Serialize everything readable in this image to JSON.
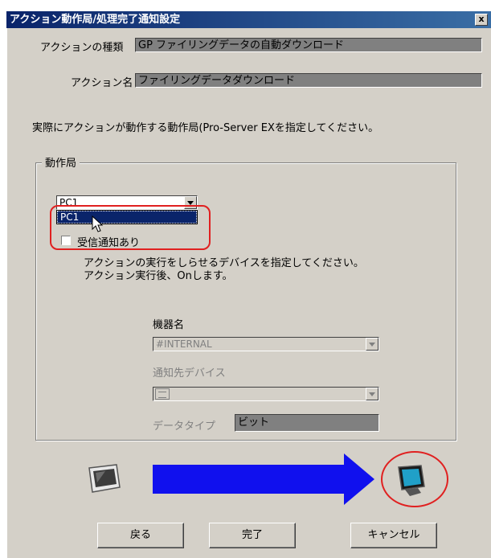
{
  "window": {
    "title": "アクション動作局/処理完了通知設定",
    "close_label": "x"
  },
  "action_type": {
    "label": "アクションの種類",
    "value": "GP ファイリングデータの自動ダウンロード"
  },
  "action_name": {
    "label": "アクション名",
    "value": "ファイリングデータダウンロード"
  },
  "instruction": "実際にアクションが動作する動作局(Pro-Server EXを指定してください。",
  "station_group": {
    "label": "動作局",
    "selected": "PC1",
    "dropdown_items": [
      "PC1"
    ],
    "checkbox_label": "受信通知あり",
    "checkbox_checked": false,
    "description_lines": [
      "アクションの実行をしらせるデバイスを指定してください。",
      "アクション実行後、Onします。"
    ],
    "device_name": {
      "label": "機器名",
      "value": "#INTERNAL"
    },
    "notify_device": {
      "label": "通知先デバイス",
      "value": ""
    },
    "data_type": {
      "label": "データタイプ",
      "value": "ビット"
    }
  },
  "buttons": {
    "back": "戻る",
    "finish": "完了",
    "cancel": "キャンセル"
  },
  "colors": {
    "arrow": "#1010ee",
    "highlight": "#e02020",
    "selection": "#0a246a"
  }
}
